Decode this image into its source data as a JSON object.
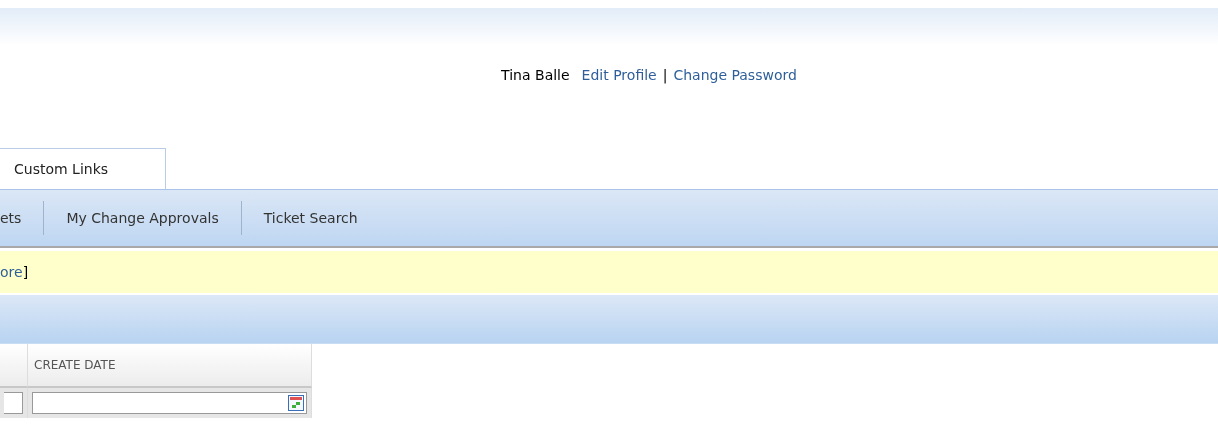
{
  "user_bar": {
    "user_name": "Tina Balle",
    "links": [
      "Edit Profile",
      "Change Password"
    ],
    "separator": "|"
  },
  "tabs": [
    {
      "label": "Custom Links",
      "selected": true
    }
  ],
  "nav_items": [
    "ets",
    "My Change Approvals",
    "Ticket Search"
  ],
  "notice": {
    "link": "ore",
    "suffix": "]"
  },
  "table": {
    "columns": [
      {
        "kind": "cut"
      },
      {
        "kind": "text",
        "label": "CREATE DATE"
      }
    ],
    "filters": [
      {
        "kind": "text"
      },
      {
        "kind": "date"
      }
    ]
  }
}
